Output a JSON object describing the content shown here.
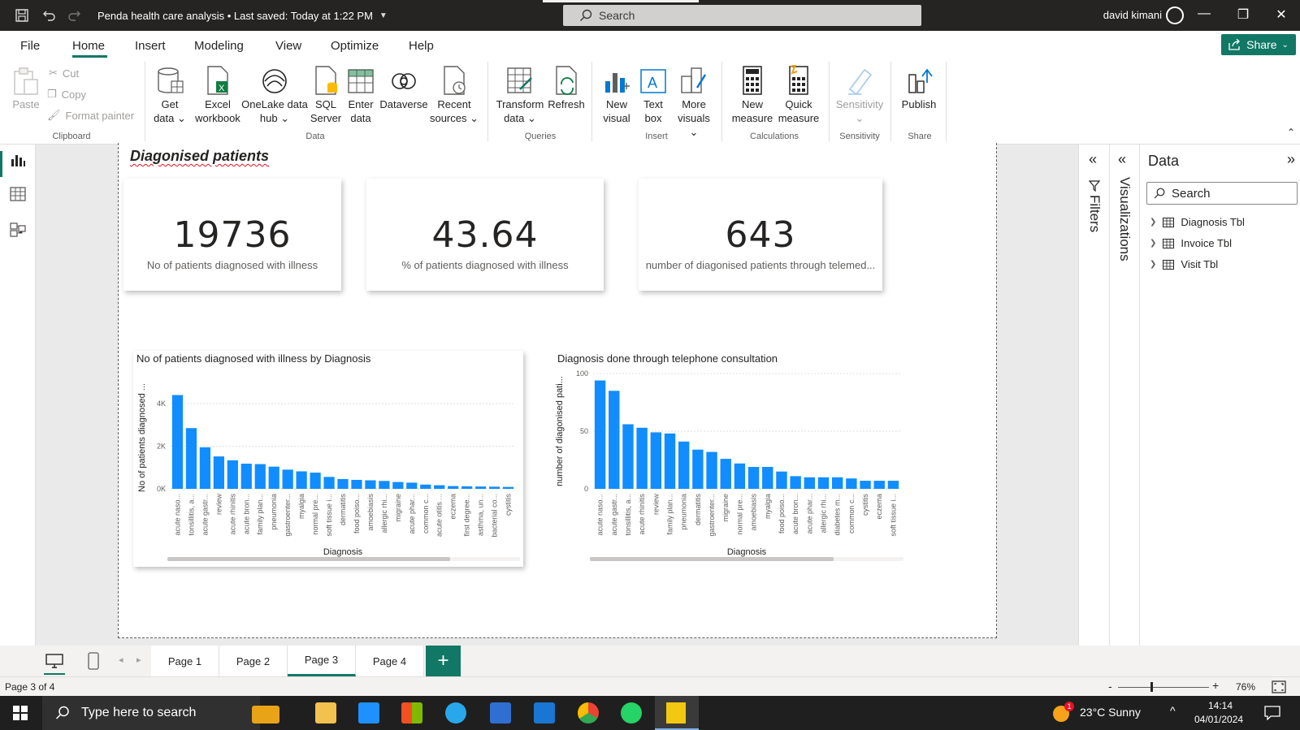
{
  "titlebar": {
    "title": "Penda health care analysis • Last saved: Today at 1:22 PM",
    "search_placeholder": "Search",
    "user": "david kimani"
  },
  "menu": [
    "File",
    "Home",
    "Insert",
    "Modeling",
    "View",
    "Optimize",
    "Help"
  ],
  "share_label": "Share",
  "ribbon": {
    "clipboard": {
      "paste": "Paste",
      "cut": "Cut",
      "copy": "Copy",
      "format_painter": "Format painter",
      "label": "Clipboard"
    },
    "data": {
      "label": "Data",
      "get_data": [
        "Get",
        "data"
      ],
      "excel": [
        "Excel",
        "workbook"
      ],
      "onelake": [
        "OneLake data",
        "hub"
      ],
      "sql": [
        "SQL",
        "Server"
      ],
      "enter": [
        "Enter",
        "data"
      ],
      "dataverse": "Dataverse",
      "recent": [
        "Recent",
        "sources"
      ]
    },
    "queries": {
      "label": "Queries",
      "transform": [
        "Transform",
        "data"
      ],
      "refresh": "Refresh"
    },
    "insert": {
      "label": "Insert",
      "new_visual": [
        "New",
        "visual"
      ],
      "text_box": [
        "Text",
        "box"
      ],
      "more_visuals": [
        "More",
        "visuals"
      ]
    },
    "calculations": {
      "label": "Calculations",
      "new_measure": [
        "New",
        "measure"
      ],
      "quick_measure": [
        "Quick",
        "measure"
      ]
    },
    "sensitivity": {
      "label": "Sensitivity",
      "button": "Sensitivity"
    },
    "share": {
      "label": "Share",
      "publish": "Publish"
    }
  },
  "page": {
    "heading": "Diagonised patients",
    "cards": [
      {
        "value": "19736",
        "label": "No of  patients diagnosed with illness"
      },
      {
        "value": "43.64",
        "label": "% of patients diagnosed with illness"
      },
      {
        "value": "643",
        "label": "number of diagonised patients through telemed..."
      }
    ]
  },
  "chart_data": [
    {
      "type": "bar",
      "title": "No of patients diagnosed with illness by Diagnosis",
      "xlabel": "Diagnosis",
      "ylabel": "No of patients diagnosed ...",
      "yticks": [
        "0K",
        "2K",
        "4K"
      ],
      "ylim": [
        0,
        4800
      ],
      "categories": [
        "acute naso...",
        "tonsillitis, a...",
        "acute gastr...",
        "review",
        "acute rhinitis",
        "acute bron...",
        "family plan...",
        "pneumonia",
        "gastroenter...",
        "myalgia",
        "normal pre...",
        "soft tissue i...",
        "dermatitis",
        "food poiso...",
        "amoebiasis",
        "allergic rhi...",
        "migraine",
        "acute phar...",
        "common c...",
        "acute otitis ...",
        "eczema",
        "first degree...",
        "asthma, un...",
        "bacterial co...",
        "cystitis"
      ],
      "values": [
        4400,
        2850,
        1950,
        1520,
        1340,
        1180,
        1160,
        1040,
        900,
        820,
        760,
        560,
        460,
        420,
        400,
        370,
        320,
        290,
        200,
        170,
        130,
        120,
        110,
        100,
        90
      ],
      "bar_color": "#118dff",
      "grid": true
    },
    {
      "type": "bar",
      "title": "Diagnosis done through telephone consultation",
      "xlabel": "Diagnosis",
      "ylabel": "number of diagonised pati...",
      "yticks": [
        "0",
        "50",
        "100"
      ],
      "ylim": [
        0,
        100
      ],
      "categories": [
        "acute naso...",
        "acute gastr...",
        "tonsillitis, a...",
        "acute rhinitis",
        "review",
        "family plan...",
        "pneumonia",
        "dermatitis",
        "gastroenter...",
        "migraine",
        "normal pre...",
        "amoebiasis",
        "myalgia",
        "food poiso...",
        "acute bron...",
        "acute phar...",
        "allergic rhi...",
        "diabetes m...",
        "common c...",
        "cystitis",
        "eczema",
        "soft tissue i..."
      ],
      "values": [
        94,
        85,
        56,
        53,
        49,
        48,
        41,
        34,
        32,
        26,
        22,
        19,
        19,
        15,
        11,
        10,
        10,
        10,
        9,
        7,
        7,
        7
      ],
      "bar_color": "#118dff",
      "grid": true
    }
  ],
  "panes": {
    "filters": "Filters",
    "visualizations": "Visualizations",
    "data_title": "Data",
    "data_search": "Search",
    "tables": [
      "Diagnosis Tbl",
      "Invoice Tbl",
      "Visit Tbl"
    ]
  },
  "page_tabs": [
    "Page 1",
    "Page 2",
    "Page 3",
    "Page 4"
  ],
  "status": {
    "page_info": "Page 3 of 4",
    "zoom": "76%"
  },
  "taskbar": {
    "search": "Type here to search",
    "weather": "23°C  Sunny",
    "time": "14:14",
    "date": "04/01/2024",
    "weather_badge": "1"
  },
  "colors": {
    "accent": "#117865",
    "bar": "#118dff",
    "titlebar": "#252423"
  }
}
